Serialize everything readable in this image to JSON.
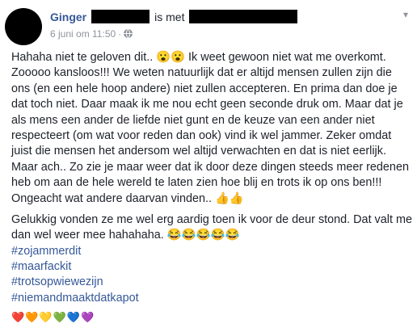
{
  "header": {
    "author": "Ginger",
    "with_text": "is met",
    "date": "6 juni om 11:50",
    "separator": "·"
  },
  "icons": {
    "privacy": "globe-icon",
    "menu": "chevron-down-icon"
  },
  "post": {
    "paragraph1": "Hahaha niet te geloven dit.. 😮😮 Ik weet gewoon niet wat me overkomt. Zooooo kansloos!!! We weten natuurlijk dat er altijd mensen zullen zijn die ons (en een hele hoop andere) niet zullen accepteren. En prima dan doe je dat toch niet. Daar maak ik me nou echt geen seconde druk om. Maar dat je als mens een ander de liefde niet gunt en de keuze van een ander niet respecteert (om wat voor reden dan ook) vind ik wel jammer. Zeker omdat juist die mensen het andersom wel altijd verwachten en dat is niet eerlijk. Maar ach.. Zo zie je maar weer dat ik door deze dingen steeds meer redenen heb om aan de hele wereld te laten zien hoe blij en trots ik op ons ben!!! Ongeacht wat andere daarvan vinden.. 👍👍",
    "paragraph2": "Gelukkig vonden ze me wel erg aardig toen ik voor de deur stond. Dat valt me dan wel weer mee hahahaha. 😂😂😂😂😂"
  },
  "hashtags": [
    "#zojammerdit",
    "#maarfackit",
    "#trotsopwiewezijn",
    "#niemandmaaktdatkapot"
  ],
  "hearts": [
    "❤️",
    "🧡",
    "💛",
    "💚",
    "💙",
    "💜"
  ]
}
